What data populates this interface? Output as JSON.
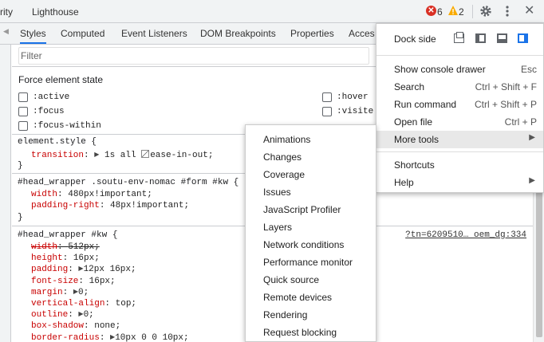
{
  "topbar": {
    "tabs": [
      "rity",
      "Lighthouse"
    ],
    "error_count": "6",
    "warning_count": "2",
    "close_glyph": "✕"
  },
  "subtabs": [
    "Styles",
    "Computed",
    "Event Listeners",
    "DOM Breakpoints",
    "Properties",
    "Acces"
  ],
  "filter": {
    "placeholder": "Filter",
    "value": ""
  },
  "force_state": {
    "title": "Force element state",
    "left": [
      ":active",
      ":focus",
      ":focus-within"
    ],
    "right": [
      ":hover",
      ":visite"
    ]
  },
  "rules": {
    "r1": {
      "selector": "element.style {",
      "prop": "transition",
      "v1": "1s all",
      "v2": "ease-in-out;",
      "close": "}"
    },
    "r2": {
      "selector": "#head_wrapper .soutu-env-nomac #form #kw {",
      "p1": "width",
      "v1": "480px!important;",
      "p2": "padding-right",
      "v2": "48px!important;",
      "close": "}"
    },
    "r3": {
      "selector": "#head_wrapper #kw {",
      "source": "?tn=6209510… oem_dg:334",
      "decls": [
        {
          "p": "width",
          "v": "512px;",
          "struck": true,
          "tri": false
        },
        {
          "p": "height",
          "v": "16px;",
          "struck": false,
          "tri": false
        },
        {
          "p": "padding",
          "v": "12px 16px;",
          "struck": false,
          "tri": true
        },
        {
          "p": "font-size",
          "v": "16px;",
          "struck": false,
          "tri": false
        },
        {
          "p": "margin",
          "v": "0;",
          "struck": false,
          "tri": true
        },
        {
          "p": "vertical-align",
          "v": "top;",
          "struck": false,
          "tri": false
        },
        {
          "p": "outline",
          "v": "0;",
          "struck": false,
          "tri": true
        },
        {
          "p": "box-shadow",
          "v": "none;",
          "struck": false,
          "tri": false
        },
        {
          "p": "border-radius",
          "v": "10px 0 0 10px;",
          "struck": false,
          "tri": true
        }
      ]
    }
  },
  "menu": {
    "dock_label": "Dock side",
    "items": [
      {
        "label": "Show console drawer",
        "shortcut": "Esc"
      },
      {
        "label": "Search",
        "shortcut": "Ctrl + Shift + F"
      },
      {
        "label": "Run command",
        "shortcut": "Ctrl + Shift + P"
      },
      {
        "label": "Open file",
        "shortcut": "Ctrl + P"
      },
      {
        "label": "More tools",
        "shortcut": "▶"
      },
      {
        "label": "Shortcuts",
        "shortcut": ""
      },
      {
        "label": "Help",
        "shortcut": "▶"
      }
    ]
  },
  "submenu": [
    "Animations",
    "Changes",
    "Coverage",
    "Issues",
    "JavaScript Profiler",
    "Layers",
    "Network conditions",
    "Performance monitor",
    "Quick source",
    "Remote devices",
    "Rendering",
    "Request blocking"
  ],
  "colors": {
    "accent": "#1a73e8",
    "prop": "#c80000",
    "error": "#d93025",
    "warning": "#f9ab00"
  }
}
